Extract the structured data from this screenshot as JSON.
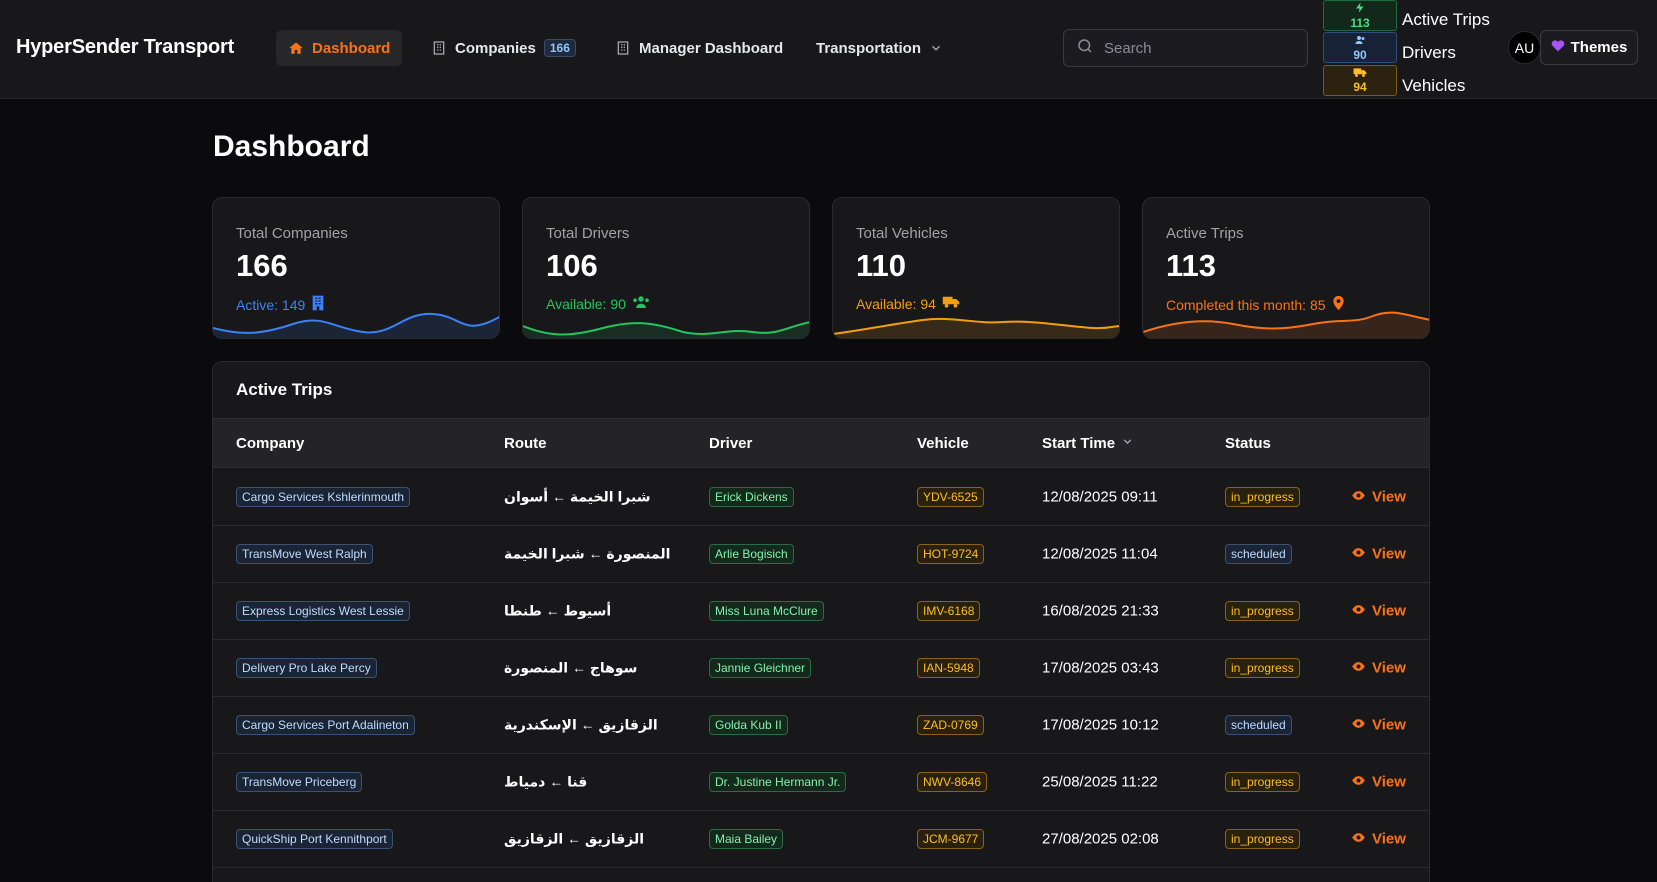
{
  "app": {
    "brand": "HyperSender Transport"
  },
  "nav": {
    "dashboard": "Dashboard",
    "companies": "Companies",
    "companies_badge": "166",
    "manager": "Manager Dashboard",
    "transportation": "Transportation"
  },
  "search": {
    "placeholder": "Search"
  },
  "quick_stats": [
    {
      "value": "113",
      "label": "Active Trips",
      "icon": "bolt-icon"
    },
    {
      "value": "90",
      "label": "Drivers",
      "icon": "users-icon"
    },
    {
      "value": "94",
      "label": "Vehicles",
      "icon": "truck-icon"
    }
  ],
  "user": {
    "initials": "AU"
  },
  "themes_label": "Themes",
  "page": {
    "title": "Dashboard"
  },
  "cards": [
    {
      "label": "Total Companies",
      "value": "166",
      "sub": "Active: 149",
      "color": "#3b82f6",
      "icon": "building-icon"
    },
    {
      "label": "Total Drivers",
      "value": "106",
      "sub": "Available: 90",
      "color": "#22c55e",
      "icon": "users-icon"
    },
    {
      "label": "Total Vehicles",
      "value": "110",
      "sub": "Available: 94",
      "color": "#f59e0b",
      "icon": "truck-icon"
    },
    {
      "label": "Active Trips",
      "value": "113",
      "sub": "Completed this month: 85",
      "color": "#f97316",
      "icon": "map-pin-icon"
    }
  ],
  "table": {
    "title": "Active Trips",
    "headers": {
      "company": "Company",
      "route": "Route",
      "driver": "Driver",
      "vehicle": "Vehicle",
      "start": "Start Time",
      "status": "Status"
    },
    "view_label": "View",
    "rows": [
      {
        "company": "Cargo Services Kshlerinmouth",
        "route": "شبرا الخيمة ← أسوان",
        "driver": "Erick Dickens",
        "vehicle": "YDV-6525",
        "start": "12/08/2025 09:11",
        "status": "in_progress"
      },
      {
        "company": "TransMove West Ralph",
        "route": "المنصورة ← شبرا الخيمة",
        "driver": "Arlie Bogisich",
        "vehicle": "HOT-9724",
        "start": "12/08/2025 11:04",
        "status": "scheduled"
      },
      {
        "company": "Express Logistics West Lessie",
        "route": "أسيوط ← طنطا",
        "driver": "Miss Luna McClure",
        "vehicle": "IMV-6168",
        "start": "16/08/2025 21:33",
        "status": "in_progress"
      },
      {
        "company": "Delivery Pro Lake Percy",
        "route": "سوهاج ← المنصورة",
        "driver": "Jannie Gleichner",
        "vehicle": "IAN-5948",
        "start": "17/08/2025 03:43",
        "status": "in_progress"
      },
      {
        "company": "Cargo Services Port Adalineton",
        "route": "الزقازيق ← الإسكندرية",
        "driver": "Golda Kub II",
        "vehicle": "ZAD-0769",
        "start": "17/08/2025 10:12",
        "status": "scheduled"
      },
      {
        "company": "TransMove Priceberg",
        "route": "قنا ← دمياط",
        "driver": "Dr. Justine Hermann Jr.",
        "vehicle": "NWV-8646",
        "start": "25/08/2025 11:22",
        "status": "in_progress"
      },
      {
        "company": "QuickShip Port Kennithport",
        "route": "الزقازيق ← الزقازيق",
        "driver": "Maia Bailey",
        "vehicle": "JCM-9677",
        "start": "27/08/2025 02:08",
        "status": "in_progress"
      }
    ]
  }
}
